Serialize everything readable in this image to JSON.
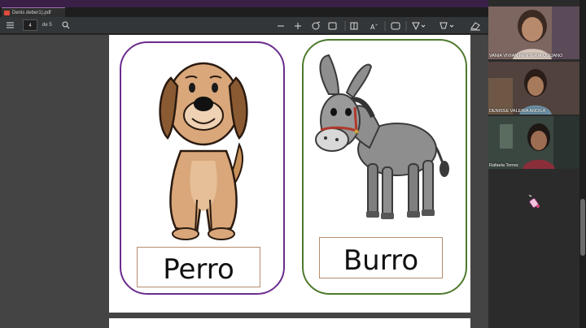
{
  "window": {
    "tab_title": "Denis deber1).pdf"
  },
  "toolbar": {
    "page_current": "4",
    "page_total": "de 5",
    "icons": [
      "menu-icon",
      "search-icon",
      "zoom-out-icon",
      "zoom-in-icon",
      "rotate-icon",
      "fit-icon",
      "page-view-icon",
      "read-aloud-icon",
      "text-icon",
      "draw-icon",
      "highlight-icon",
      "erase-icon"
    ]
  },
  "cards": [
    {
      "animal": "dog",
      "label": "Perro",
      "border_color": "#6a2c8c"
    },
    {
      "animal": "donkey",
      "label": "Burro",
      "border_color": "#4e7a2e"
    }
  ],
  "participants": [
    {
      "name": "VANIA VIVIAN RENTERIA QUIJANO"
    },
    {
      "name": "DENISSE  VALERIA ARDILA"
    },
    {
      "name": "Rafaela Torres"
    }
  ],
  "colors": {
    "accent": "#3a1f47",
    "toolbar": "#323639",
    "viewer_bg": "#444444"
  }
}
